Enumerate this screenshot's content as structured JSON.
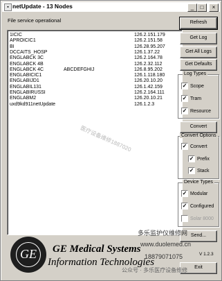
{
  "window": {
    "title": "netUpdate - 13 Nodes",
    "icon": "app-icon",
    "controls": [
      "minimize-icon",
      "maximize-icon",
      "close-icon"
    ]
  },
  "status_text": "File service operational",
  "nodes": [
    {
      "name": "1ICIC",
      "extra": "",
      "ip": "126.2.151.179"
    },
    {
      "name": "APROICIC1",
      "extra": "",
      "ip": "126.2.151.58"
    },
    {
      "name": "BI",
      "extra": "",
      "ip": "126.28.95.207"
    },
    {
      "name": "DCCAITS_HOSP",
      "extra": "",
      "ip": "126.1.37.22"
    },
    {
      "name": "ENGLABCK 3C",
      "extra": "",
      "ip": "126.2.164.78"
    },
    {
      "name": "ENGLABCK 4B",
      "extra": "",
      "ip": "126.2.32.112"
    },
    {
      "name": "ENGLABCK 4C",
      "extra": "ABCDEFGHIJ",
      "ip": "126.8.95.202"
    },
    {
      "name": "ENGLABICIC1",
      "extra": "",
      "ip": "126.1.118.180"
    },
    {
      "name": "ENGLABIJD1",
      "extra": "",
      "ip": "126.20.10.20"
    },
    {
      "name": "ENGLABIL131",
      "extra": "",
      "ip": "126.1.42.159"
    },
    {
      "name": "ENGLABIRUSSI",
      "extra": "",
      "ip": "126.2.164.111"
    },
    {
      "name": "ENGLABM2",
      "extra": "",
      "ip": "126.20.10.21"
    },
    {
      "name": "uxd9kd911netUpdate",
      "extra": "",
      "ip": "126.1.2.3"
    }
  ],
  "buttons": {
    "refresh": "Refresh",
    "get_log": "Get Log",
    "get_all_logs": "Get All Logs",
    "get_defaults": "Get Defaults",
    "convert": "Convert",
    "send": "Send...",
    "exit": "Exit"
  },
  "log_types": {
    "label": "Log Types",
    "scope": "Scope",
    "tram": "Tram",
    "resource": "Resource"
  },
  "convert_options": {
    "label": "Convert Options",
    "convert": "Convert",
    "prefix": "Prefix",
    "stack": "Stack"
  },
  "device_types": {
    "label": "Device Types",
    "modular": "Modular",
    "configured": "Configured",
    "solar": "Solar 8000"
  },
  "version_text": "V 1.2.3",
  "brand": {
    "logo_text": "GE",
    "line1": "GE Medical Systems",
    "line2": "Information Technologies"
  },
  "watermarks": {
    "w1": "医疗设备维修1887020",
    "w2": "多乐监护仪维修网",
    "w3": "www.duolemed.cn",
    "w4": "18879071075",
    "w5": "公众号 · 多乐医疗设备维修"
  }
}
